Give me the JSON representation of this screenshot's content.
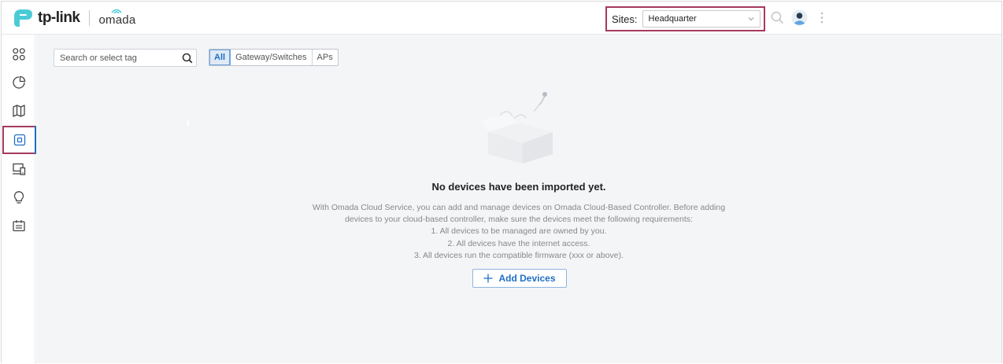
{
  "header": {
    "brand": "tp-link",
    "product": "omada",
    "sites_label": "Sites:",
    "selected_site": "Headquarter",
    "icons": [
      "search-icon",
      "user-avatar",
      "more-vertical-icon"
    ]
  },
  "sidebar": {
    "items": [
      {
        "icon": "dashboard-icon"
      },
      {
        "icon": "statistics-icon"
      },
      {
        "icon": "map-icon"
      },
      {
        "icon": "devices-icon",
        "active": true
      },
      {
        "icon": "clients-icon"
      },
      {
        "icon": "insights-icon"
      },
      {
        "icon": "logs-icon"
      }
    ]
  },
  "toolbar": {
    "search_placeholder": "Search or select tag",
    "tabs": [
      {
        "label": "All",
        "active": true
      },
      {
        "label": "Gateway/Switches"
      },
      {
        "label": "APs"
      }
    ]
  },
  "empty_state": {
    "title": "No devices have been imported yet.",
    "description_line1": "With Omada Cloud Service, you can add and manage devices on Omada Cloud-Based Controller. Before adding",
    "description_line2": "devices to your cloud-based controller, make sure the devices meet the following requirements:",
    "requirements": [
      "1. All devices to be managed are owned by you.",
      "2. All devices have the internet access.",
      "3. All devices run the compatible firmware (xxx or above)."
    ],
    "button_label": "Add Devices"
  },
  "colors": {
    "accent": "#1f6fc5",
    "highlight_border": "#a7395c",
    "brand_teal": "#4acbd6",
    "main_bg": "#f4f5f7"
  }
}
